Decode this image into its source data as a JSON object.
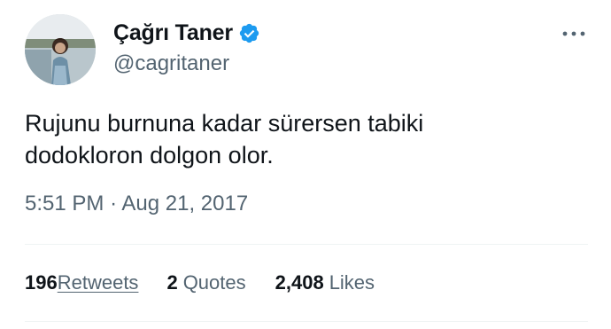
{
  "author": {
    "display_name": "Çağrı Taner",
    "handle": "@cagritaner",
    "verified": true,
    "verified_color": "#1d9bf0",
    "avatar_icon": "profile-photo"
  },
  "more_icon": "more-horizontal-icon",
  "tweet": {
    "text_lines": [
      "Rujunu burnuna kadar sürersen tabiki",
      "dodokloron dolgon olor."
    ]
  },
  "meta": {
    "time": "5:51 PM",
    "separator": "·",
    "date": "Aug 21, 2017"
  },
  "stats": {
    "retweets_count": "196",
    "retweets_label": " Retweets",
    "quotes_count": "2",
    "quotes_label": "Quotes",
    "likes_count": "2,408",
    "likes_label": "Likes"
  },
  "colors": {
    "text_primary": "#0f1419",
    "text_secondary": "#536471",
    "divider": "#eff3f4"
  }
}
